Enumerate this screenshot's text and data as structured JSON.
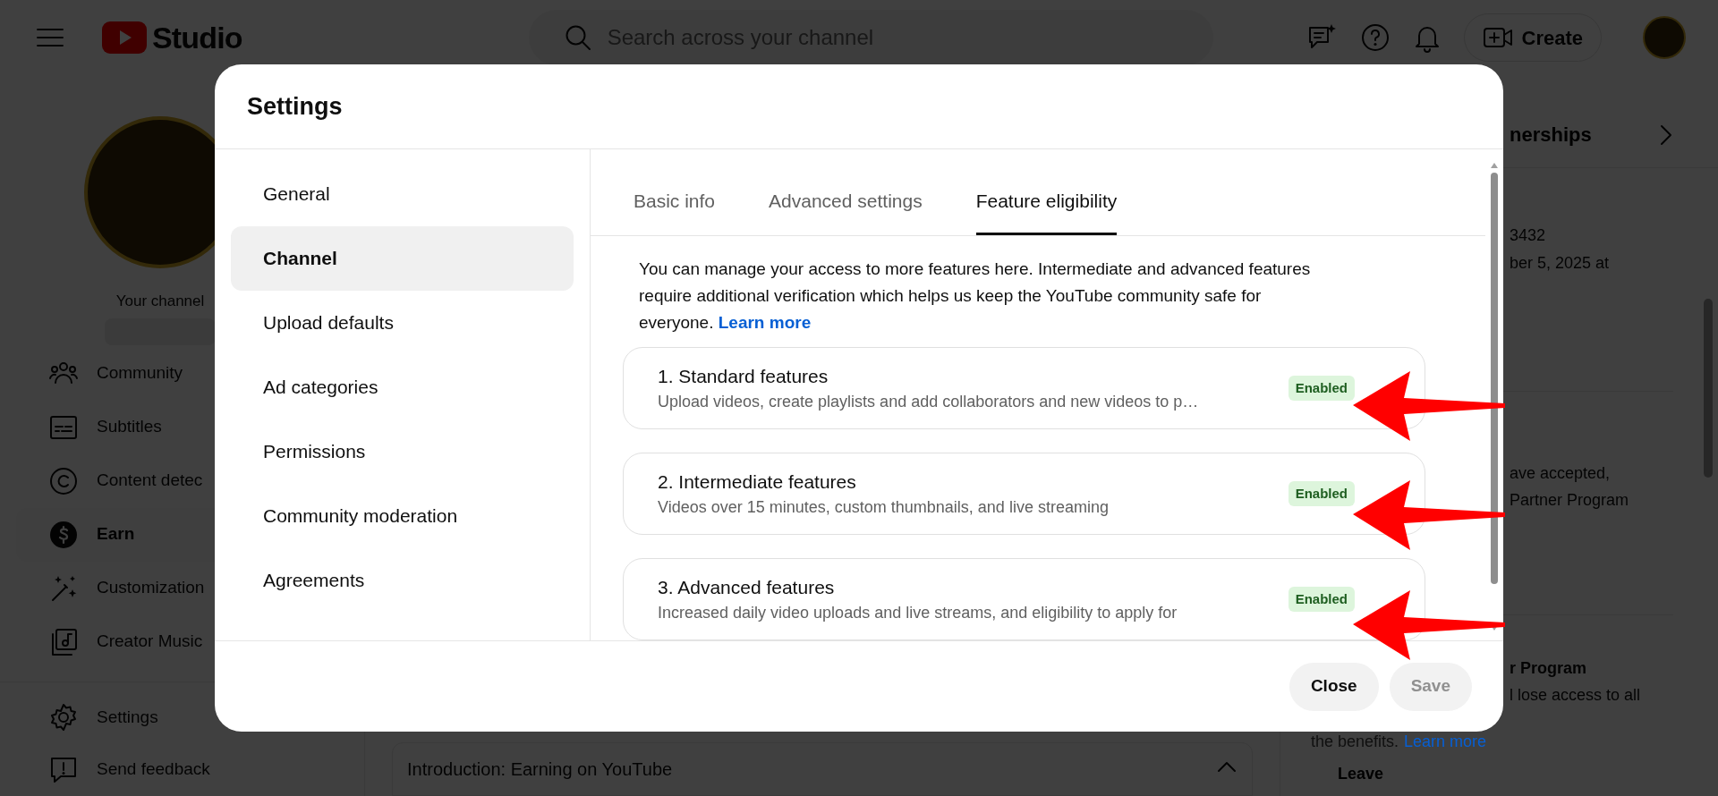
{
  "header": {
    "logo_text": "Studio",
    "search": {
      "placeholder": "Search across your channel"
    },
    "create_button": "Create"
  },
  "sidebar": {
    "channel_label": "Your channel",
    "items": [
      {
        "label": "Community",
        "selected": false
      },
      {
        "label": "Subtitles",
        "selected": false
      },
      {
        "label": "Content detec",
        "selected": false
      },
      {
        "label": "Earn",
        "selected": true
      },
      {
        "label": "Customization",
        "selected": false
      },
      {
        "label": "Creator Music",
        "selected": false
      }
    ],
    "footer_items": [
      {
        "label": "Settings"
      },
      {
        "label": "Send feedback"
      }
    ]
  },
  "main": {
    "section_title": "Introduction: Earning on YouTube"
  },
  "right_panel": {
    "tab": "nerships",
    "lines_1": [
      "3432",
      "ber 5, 2025 at"
    ],
    "lines_2": [
      "ave accepted,",
      "Partner Program"
    ],
    "section_title": "r Program",
    "section_text": "l lose access to all",
    "section_text_2": "the benefits.",
    "link": "Learn more",
    "button": "Leave"
  },
  "dialog": {
    "title": "Settings",
    "nav": [
      {
        "label": "General",
        "selected": false
      },
      {
        "label": "Channel",
        "selected": true
      },
      {
        "label": "Upload defaults",
        "selected": false
      },
      {
        "label": "Ad categories",
        "selected": false
      },
      {
        "label": "Permissions",
        "selected": false
      },
      {
        "label": "Community moderation",
        "selected": false
      },
      {
        "label": "Agreements",
        "selected": false
      }
    ],
    "tabs": [
      {
        "label": "Basic info",
        "selected": false
      },
      {
        "label": "Advanced settings",
        "selected": false
      },
      {
        "label": "Feature eligibility",
        "selected": true
      }
    ],
    "intro": "You can manage your access to more features here. Intermediate and advanced features require additional verification which helps us keep the YouTube community safe for everyone.",
    "intro_link": "Learn more",
    "features": [
      {
        "title": "1. Standard features",
        "description": "Upload videos, create playlists and add collaborators and new videos to p…",
        "status": "Enabled"
      },
      {
        "title": "2. Intermediate features",
        "description": "Videos over 15 minutes, custom thumbnails, and live streaming",
        "status": "Enabled"
      },
      {
        "title": "3. Advanced features",
        "description": "Increased daily video uploads and live streams, and eligibility to apply for",
        "status": "Enabled"
      }
    ],
    "buttons": [
      {
        "label": "Close",
        "disabled": false
      },
      {
        "label": "Save",
        "disabled": true
      }
    ]
  }
}
